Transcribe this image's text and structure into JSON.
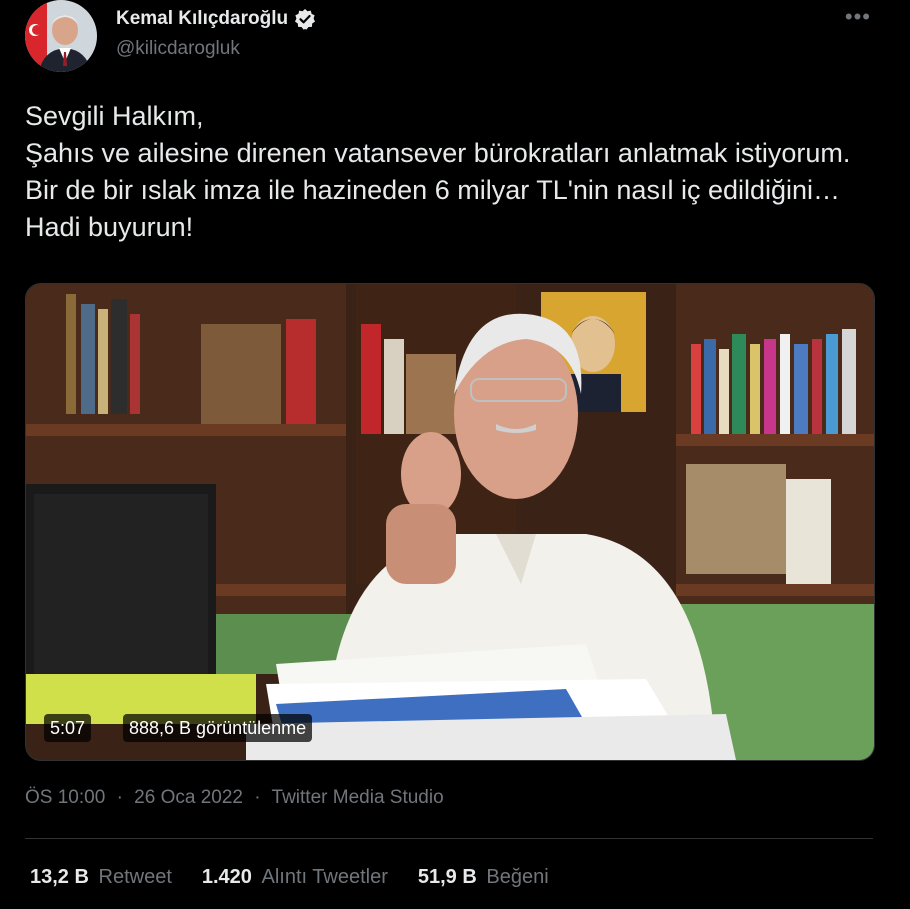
{
  "author": {
    "name": "Kemal Kılıçdaroğlu",
    "handle": "@kilicdarogluk"
  },
  "tweet": {
    "text": "Sevgili Halkım,\nŞahıs ve ailesine direnen vatansever bürokratları anlatmak istiyorum. Bir de bir ıslak imza ile hazineden 6 milyar TL'nin nasıl iç edildiğini… Hadi buyurun!"
  },
  "media": {
    "duration": "5:07",
    "views": "888,6 B görüntülenme"
  },
  "meta": {
    "time": "ÖS 10:00",
    "date": "26 Oca 2022",
    "source": "Twitter Media Studio",
    "separator": "·"
  },
  "stats": {
    "retweets": {
      "count": "13,2 B",
      "label": "Retweet"
    },
    "quotes": {
      "count": "1.420",
      "label": "Alıntı Tweetler"
    },
    "likes": {
      "count": "51,9 B",
      "label": "Beğeni"
    }
  },
  "icons": {
    "verified": "verified-badge-icon",
    "more": "more-options-icon"
  },
  "colors": {
    "background": "#000000",
    "text": "#e7e9ea",
    "muted": "#71767b",
    "verified": "#e7e9ea"
  }
}
